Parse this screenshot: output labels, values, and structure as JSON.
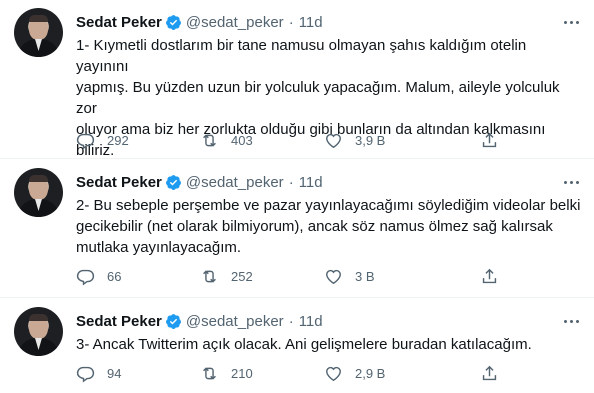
{
  "tweets": [
    {
      "author": "Sedat Peker",
      "handle": "@sedat_peker",
      "separator": "·",
      "time": "11d",
      "text": "1- Kıymetli dostlarım bir tane namusu olmayan şahıs kaldığım otelin yayınını\nyapmış. Bu yüzden uzun bir yolculuk yapacağım. Malum, aileyle yolculuk zor\noluyor ama biz her zorlukta olduğu gibi bunların da altından kalkmasını\nbiliriz.",
      "replies": "292",
      "retweets": "403",
      "likes": "3,9 B"
    },
    {
      "author": "Sedat Peker",
      "handle": "@sedat_peker",
      "separator": "·",
      "time": "11d",
      "text": "2- Bu sebeple perşembe ve pazar yayınlayacağımı söylediğim videolar belki\ngecikebilir (net olarak bilmiyorum), ancak söz namus ölmez sağ kalırsak\nmutlaka yayınlayacağım.",
      "replies": "66",
      "retweets": "252",
      "likes": "3 B"
    },
    {
      "author": "Sedat Peker",
      "handle": "@sedat_peker",
      "separator": "·",
      "time": "11d",
      "text": "3- Ancak Twitterim açık olacak. Ani gelişmelere buradan katılacağım.",
      "replies": "94",
      "retweets": "210",
      "likes": "2,9 B"
    }
  ],
  "colors": {
    "text": "#0f1419",
    "secondary": "#536471",
    "verified": "#1d9bf0",
    "divider": "#eff3f4"
  },
  "icons": [
    "more-icon",
    "verified-badge-icon",
    "reply-icon",
    "retweet-icon",
    "like-icon",
    "share-icon"
  ]
}
